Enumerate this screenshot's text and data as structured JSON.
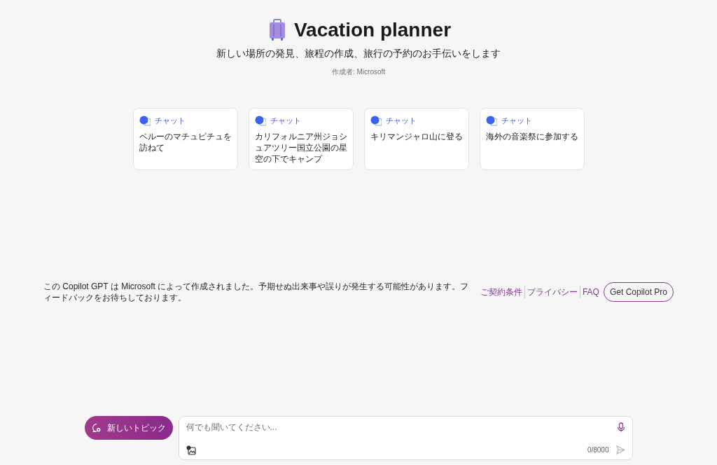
{
  "header": {
    "title": "Vacation planner",
    "description": "新しい場所の発見、旅程の作成、旅行の予約のお手伝いをします",
    "author": "作成者: Microsoft"
  },
  "prompt_cards": [
    {
      "kind": "chat",
      "label": "チャット",
      "text": "ペルーのマチュピチュを訪ねて"
    },
    {
      "kind": "chat",
      "label": "チャット",
      "text": "カリフォルニア州ジョシュアツリー国立公園の星空の下でキャンプ"
    },
    {
      "kind": "chat",
      "label": "チャット",
      "text": "キリマンジャロ山に登る"
    },
    {
      "kind": "chat",
      "label": "チャット",
      "text": "海外の音楽祭に参加する"
    }
  ],
  "footer": {
    "disclaimer": "この Copilot GPT は Microsoft によって作成されました。予期せぬ出来事や誤りが発生する可能性があります。フィードバックをお待ちしております。",
    "links": [
      "ご契約条件",
      "プライバシー",
      "FAQ"
    ],
    "button": "Get Copilot Pro"
  },
  "composer": {
    "new_topic_button": "新しいトピック",
    "input": {
      "placeholder": "何でも聞いてください..."
    },
    "counter": "0/8000"
  }
}
